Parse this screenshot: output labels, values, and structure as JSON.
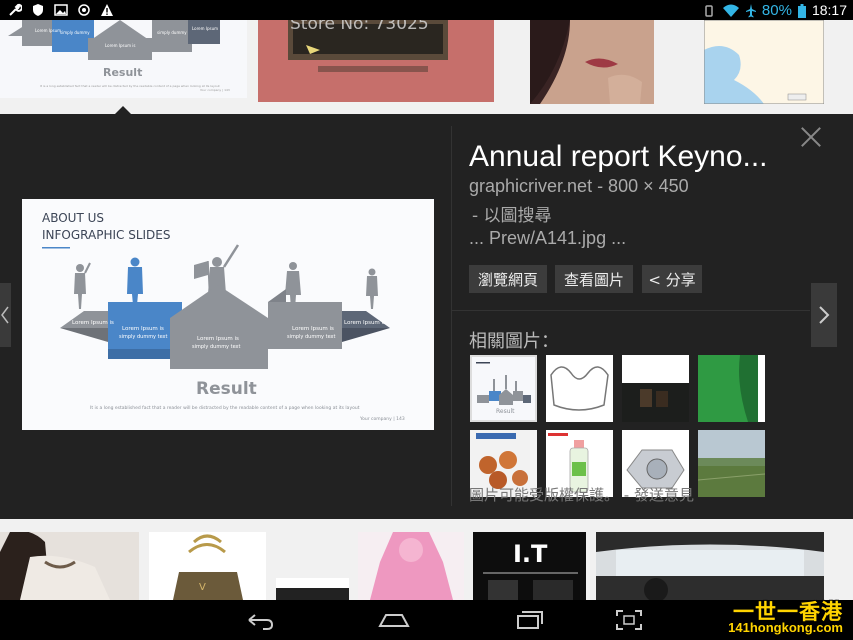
{
  "status_bar": {
    "battery": "80%",
    "time": "18:17"
  },
  "detail": {
    "title": "Annual report Keyno...",
    "source": "graphicriver.net - 800 × 450",
    "search_by_image": "- 以圖搜尋",
    "url": "... Prew/A141.jpg ...",
    "buttons": {
      "visit": "瀏覽網頁",
      "view": "查看圖片",
      "share": "< 分享"
    },
    "related_label": "相關圖片：",
    "copyright": "圖片可能受版權保護。 - 發送意見"
  },
  "preview": {
    "heading_line1": "ABOUT US",
    "heading_line2": "INFOGRAPHIC SLIDES",
    "result": "Result",
    "lorem_short": "Lorem Ipsum is",
    "lorem_body": "simply dummy text",
    "caption": "It is a long established fact that a reader will be distracted by the readable content of a page when looking at its layout",
    "footer": "Your company  |  143"
  },
  "top_thumb": {
    "result": "Result",
    "store_text": "Store No: 73025"
  },
  "colors": {
    "accent_blue": "#33b5e5",
    "panel_bg": "#222222",
    "slide_blue": "#4a86c8",
    "slide_gray": "#8f9399",
    "watermark_yellow": "#ffd400"
  },
  "watermark": {
    "title": "一世一香港",
    "site": "141hongkong.com"
  }
}
